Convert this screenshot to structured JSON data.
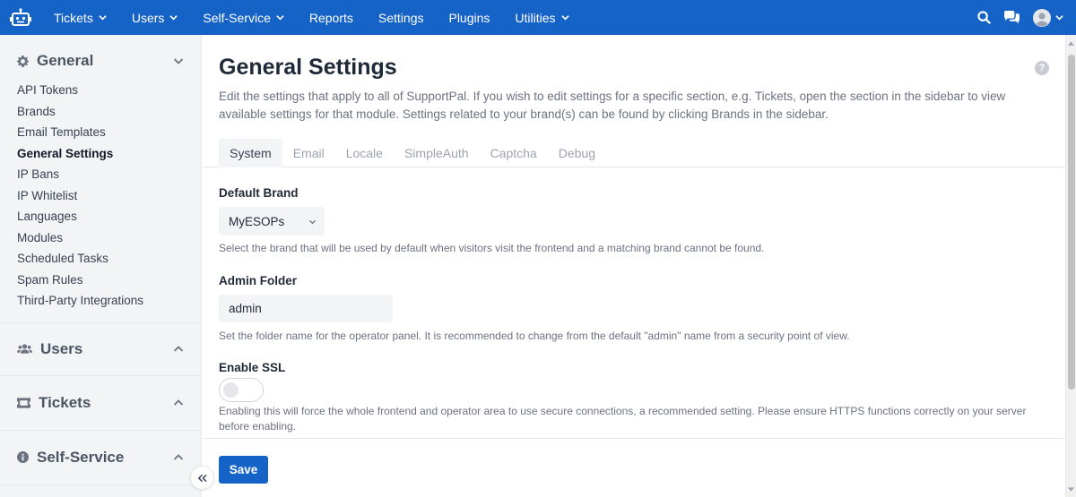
{
  "topnav": {
    "items": [
      {
        "label": "Tickets",
        "dropdown": true
      },
      {
        "label": "Users",
        "dropdown": true
      },
      {
        "label": "Self-Service",
        "dropdown": true
      },
      {
        "label": "Reports",
        "dropdown": false
      },
      {
        "label": "Settings",
        "dropdown": false
      },
      {
        "label": "Plugins",
        "dropdown": false
      },
      {
        "label": "Utilities",
        "dropdown": true
      }
    ],
    "icons": [
      "logo-icon",
      "search-icon",
      "chat-icon",
      "user-avatar-icon",
      "chevron-down-icon"
    ],
    "color": "#1663c7"
  },
  "sidebar": {
    "general": {
      "title": "General",
      "items": [
        {
          "label": "API Tokens",
          "active": false
        },
        {
          "label": "Brands",
          "active": false
        },
        {
          "label": "Email Templates",
          "active": false
        },
        {
          "label": "General Settings",
          "active": true
        },
        {
          "label": "IP Bans",
          "active": false
        },
        {
          "label": "IP Whitelist",
          "active": false
        },
        {
          "label": "Languages",
          "active": false
        },
        {
          "label": "Modules",
          "active": false
        },
        {
          "label": "Scheduled Tasks",
          "active": false
        },
        {
          "label": "Spam Rules",
          "active": false
        },
        {
          "label": "Third-Party Integrations",
          "active": false
        }
      ]
    },
    "users": {
      "title": "Users"
    },
    "tickets": {
      "title": "Tickets"
    },
    "self_service": {
      "title": "Self-Service"
    }
  },
  "main": {
    "title": "General Settings",
    "intro": "Edit the settings that apply to all of SupportPal. If you wish to edit settings for a specific section, e.g. Tickets, open the section in the sidebar to view available settings for that module. Settings related to your brand(s) can be found by clicking Brands in the sidebar.",
    "tabs": [
      {
        "label": "System",
        "active": true
      },
      {
        "label": "Email",
        "active": false
      },
      {
        "label": "Locale",
        "active": false
      },
      {
        "label": "SimpleAuth",
        "active": false
      },
      {
        "label": "Captcha",
        "active": false
      },
      {
        "label": "Debug",
        "active": false
      }
    ],
    "default_brand": {
      "label": "Default Brand",
      "value": "MyESOPs",
      "help": "Select the brand that will be used by default when visitors visit the frontend and a matching brand cannot be found."
    },
    "admin_folder": {
      "label": "Admin Folder",
      "value": "admin",
      "help": "Set the folder name for the operator panel. It is recommended to change from the default \"admin\" name from a security point of view."
    },
    "enable_ssl": {
      "label": "Enable SSL",
      "enabled": false,
      "help": "Enabling this will force the whole frontend and operator area to use secure connections, a recommended setting. Please ensure HTTPS functions correctly on your server before enabling."
    },
    "save_label": "Save"
  }
}
